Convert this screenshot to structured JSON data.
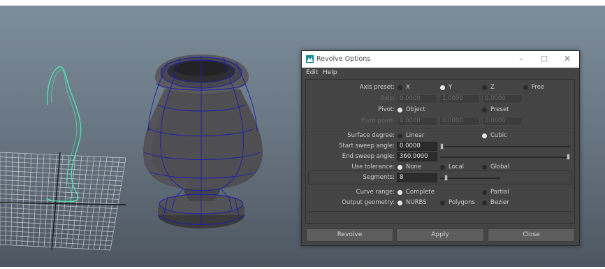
{
  "dialog": {
    "title": "Revolve Options",
    "menu": [
      "Edit",
      "Help"
    ],
    "window_controls": {
      "minimize": "–",
      "maximize": "☐",
      "close": "✕"
    },
    "axis_preset": {
      "label": "Axis preset:",
      "options": [
        "X",
        "Y",
        "Z",
        "Free"
      ],
      "selected": "Y"
    },
    "axis": {
      "label": "Axis:",
      "values": [
        "0.0000",
        "1.0000",
        "0.0000"
      ]
    },
    "pivot": {
      "label": "Pivot:",
      "options": [
        "Object",
        "Preset"
      ],
      "selected": "Object"
    },
    "pivot_point": {
      "label": "Pivot point:",
      "values": [
        "0.0000",
        "0.0000",
        "0.0000"
      ]
    },
    "surface_degree": {
      "label": "Surface degree:",
      "options": [
        "Linear",
        "Cubic"
      ],
      "selected": "Cubic"
    },
    "start_sweep": {
      "label": "Start sweep angle:",
      "value": "0.0000",
      "slider_fraction": 0.0
    },
    "end_sweep": {
      "label": "End sweep angle:",
      "value": "360.0000",
      "slider_fraction": 1.0
    },
    "use_tolerance": {
      "label": "Use tolerance:",
      "options": [
        "None",
        "Local",
        "Global"
      ],
      "selected": "None"
    },
    "segments": {
      "label": "Segments:",
      "value": "8",
      "slider_fraction": 0.08
    },
    "curve_range": {
      "label": "Curve range:",
      "options": [
        "Complete",
        "Partial"
      ],
      "selected": "Complete"
    },
    "output_geometry": {
      "label": "Output geometry:",
      "options": [
        "NURBS",
        "Polygons",
        "Bezier"
      ],
      "selected": "NURBS"
    },
    "buttons": {
      "revolve": "Revolve",
      "apply": "Apply",
      "close": "Close"
    }
  },
  "colors": {
    "viewport_top": "#7f8e9c",
    "viewport_bottom": "#4d5660",
    "curve": "#4fe3b0",
    "mesh_wire": "#1c1cb0",
    "dialog_bg": "#444444"
  }
}
